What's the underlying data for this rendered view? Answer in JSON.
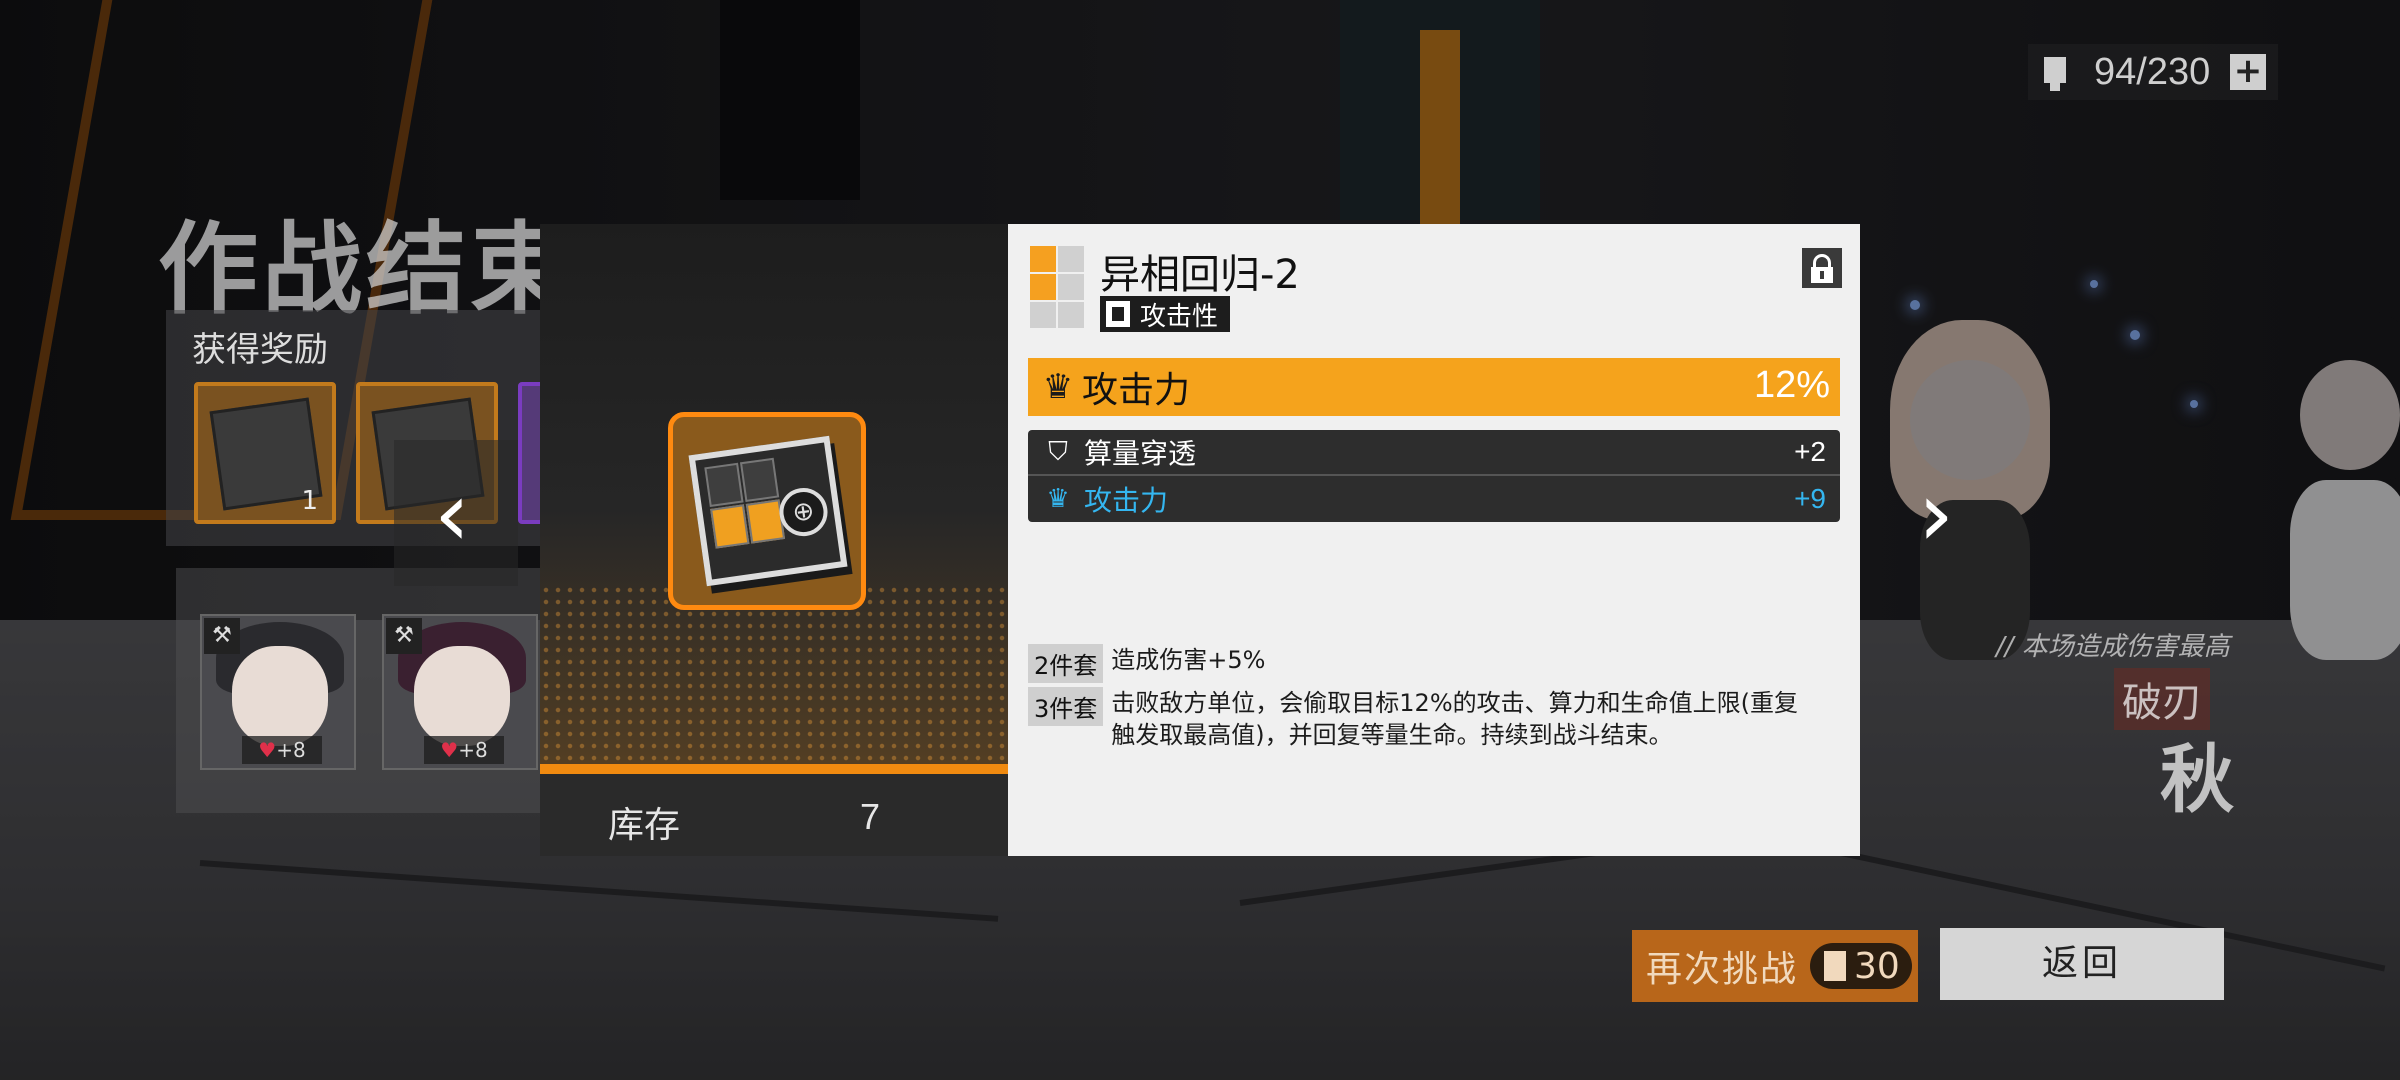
{
  "stamina": {
    "value": "94/230",
    "plus": "+"
  },
  "results": {
    "title": "作战结束",
    "rewards_label": "获得奖励",
    "reward_count": "1"
  },
  "team": [
    {
      "affection": "+8"
    },
    {
      "affection": "+8"
    }
  ],
  "modal": {
    "item_name": "异相回归-2",
    "type_tag": "攻击性",
    "main_stat": {
      "name": "攻击力",
      "value": "12%"
    },
    "sub_stats": [
      {
        "name": "算量穿透",
        "value": "+2"
      },
      {
        "name": "攻击力",
        "value": "+9"
      }
    ],
    "set_effects": [
      {
        "tag": "2件套",
        "desc": "造成伤害+5%"
      },
      {
        "tag": "3件套",
        "desc": "击败敌方单位，会偷取目标12%的攻击、算力和生命值上限(重复触发取最高值)，并回复等量生命。持续到战斗结束。"
      }
    ],
    "stock_label": "库存",
    "stock_value": "7"
  },
  "mvp": {
    "caption": "// 本场造成伤害最高",
    "title": "破刃",
    "name": "秋"
  },
  "buttons": {
    "retry": "再次挑战",
    "retry_cost": "30",
    "return": "返回"
  },
  "nav": {
    "prev": "‹",
    "next": "›"
  },
  "colors": {
    "accent_orange": "#f5a31c",
    "rarity_orange": "#f08a10",
    "substat_blue": "#34b6f0",
    "panel_light": "#f0f0f0"
  }
}
